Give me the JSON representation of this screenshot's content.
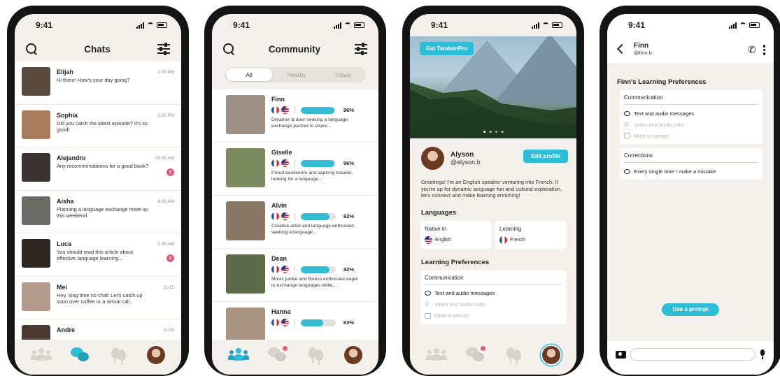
{
  "status_time": "9:41",
  "colors": {
    "accent": "#2fbcd6",
    "badge": "#e0607a",
    "bg": "#f4f1ec"
  },
  "chats": {
    "title": "Chats",
    "items": [
      {
        "name": "Elijah",
        "message": "Hi there! How's your day going?",
        "time": "2:00 PM",
        "badge": "",
        "photo": "#5a4a3e"
      },
      {
        "name": "Sophia",
        "message": "Did you catch the latest episode? It's so good!",
        "time": "1:20 PM",
        "badge": "",
        "photo": "#a87c5c"
      },
      {
        "name": "Alejandro",
        "message": "Any recommendations for a good book?",
        "time": "10:00 AM",
        "badge": "1",
        "photo": "#3a3330"
      },
      {
        "name": "Aisha",
        "message": "Planning a language exchange meet-up this weekend.",
        "time": "8:00 AM",
        "badge": "",
        "photo": "#6a6b64"
      },
      {
        "name": "Luca",
        "message": "You should read this article about effective language learning...",
        "time": "2:30 AM",
        "badge": "1",
        "photo": "#2d2520"
      },
      {
        "name": "Mei",
        "message": "Hey, long time no chat! Let's catch up soon over coffee or a virtual call.",
        "time": "11/15",
        "badge": "",
        "photo": "#b49a8a"
      },
      {
        "name": "Andre",
        "message": "",
        "time": "11/15",
        "badge": "",
        "photo": "#4a3a30"
      }
    ]
  },
  "community": {
    "title": "Community",
    "tabs": [
      "All",
      "Nearby",
      "Travel"
    ],
    "active_tab": "All",
    "items": [
      {
        "name": "Finn",
        "percent_label": "96%",
        "progress": 0.96,
        "description": "Dreamer & doer seeking a language exchange partner to share...",
        "photo": "#9d8f84"
      },
      {
        "name": "Giselle",
        "percent_label": "96%",
        "progress": 0.96,
        "description": "Proud bookworm and aspiring traveler, looking for a language...",
        "photo": "#7a8a5e"
      },
      {
        "name": "Alvin",
        "percent_label": "82%",
        "progress": 0.82,
        "description": "Creative artist and language enthusiast, seeking a language...",
        "photo": "#8a7866"
      },
      {
        "name": "Dean",
        "percent_label": "82%",
        "progress": 0.82,
        "description": "Music junkie and fitness enthusiast eager to exchange languages while...",
        "photo": "#5c6a4a"
      },
      {
        "name": "Hanna",
        "percent_label": "63%",
        "progress": 0.63,
        "description": "",
        "photo": "#a89480"
      }
    ]
  },
  "profile": {
    "pro_button": "Get TandemPro",
    "name": "Alyson",
    "handle": "@alyson.b",
    "edit_button": "Edit profile",
    "bio": "Greetings! I'm an English speaker venturing into French. If you're up for dynamic language fun and cultural exploration, let's connect and make learning enriching!",
    "languages_title": "Languages",
    "native_label": "Native in",
    "native_value": "English",
    "learning_label": "Learning",
    "learning_value": "French",
    "prefs_title": "Learning Preferences",
    "communication_label": "Communication",
    "prefs": [
      {
        "label": "Text and audio messages",
        "enabled": true,
        "icon": "speech-bubble-icon"
      },
      {
        "label": "Video and audio calls",
        "enabled": false,
        "icon": "phone-icon"
      },
      {
        "label": "Meet in person",
        "enabled": false,
        "icon": "person-icon"
      }
    ]
  },
  "chat_detail": {
    "name": "Finn",
    "handle": "@finn.b",
    "prefs_title": "Finn's Learning Preferences",
    "communication_label": "Communication",
    "prefs": [
      {
        "label": "Text and audio messages",
        "enabled": true
      },
      {
        "label": "Video and audio calls",
        "enabled": false
      },
      {
        "label": "Meet in person",
        "enabled": false
      }
    ],
    "corrections_label": "Corrections",
    "corrections_value": "Every single time I make a mistake",
    "prompt_button": "Use a prompt",
    "input_placeholder": ""
  }
}
